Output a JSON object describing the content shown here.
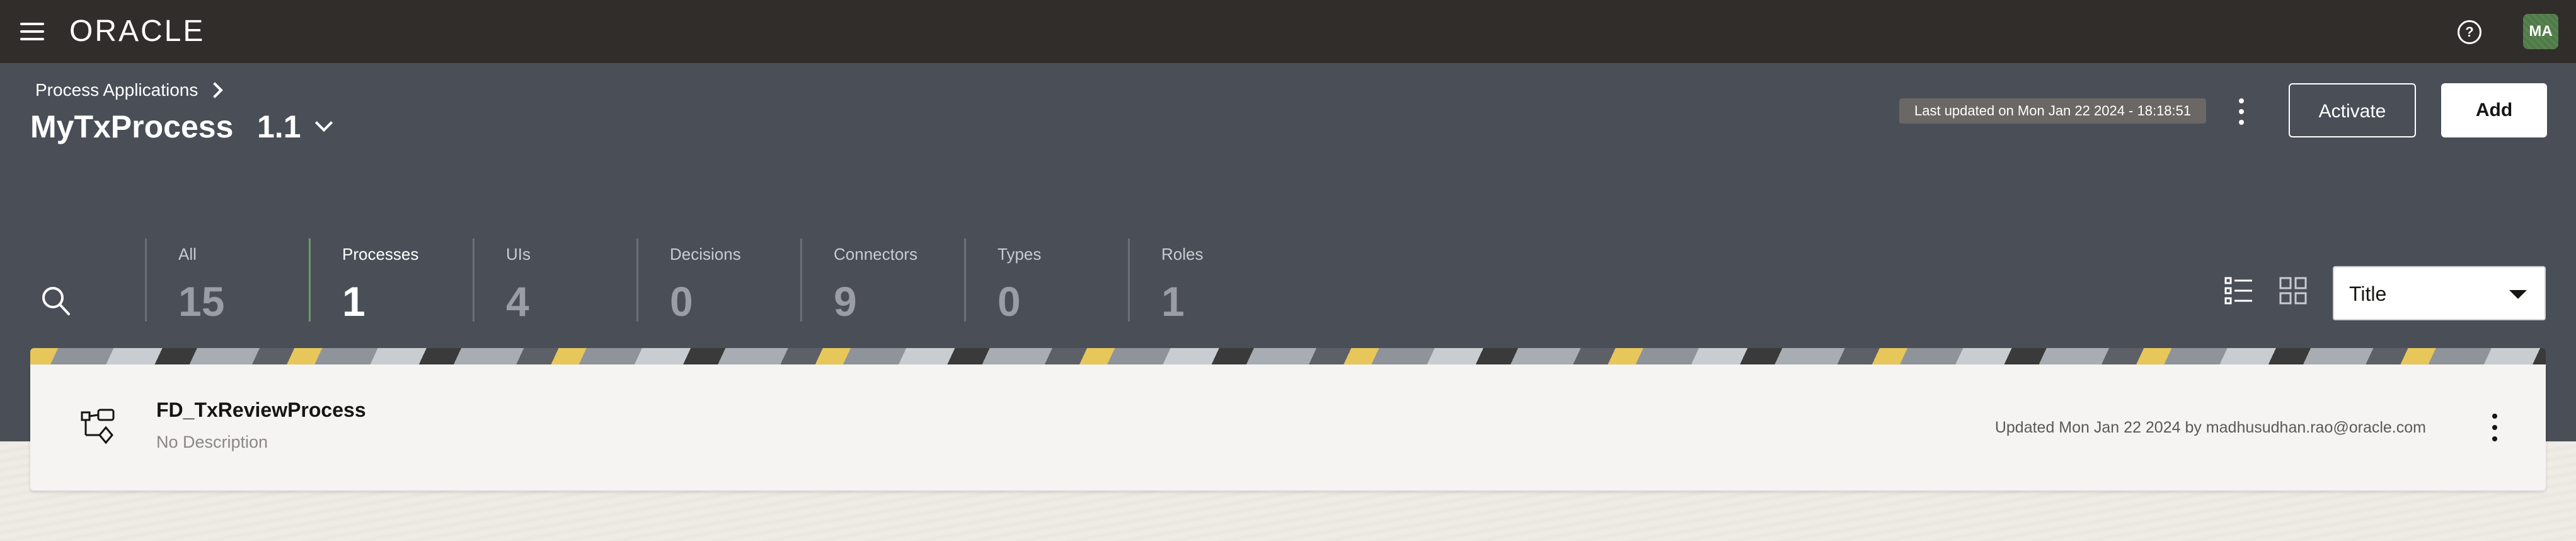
{
  "app": {
    "logo_text": "ORACLE",
    "avatar_initials": "MA",
    "help_glyph": "?"
  },
  "header": {
    "breadcrumb": "Process Applications",
    "title": "MyTxProcess",
    "version": "1.1",
    "last_updated": "Last updated on Mon Jan 22 2024 - 18:18:51",
    "activate_label": "Activate",
    "add_label": "Add"
  },
  "categories": [
    {
      "label": "All",
      "count": "15"
    },
    {
      "label": "Processes",
      "count": "1"
    },
    {
      "label": "UIs",
      "count": "4"
    },
    {
      "label": "Decisions",
      "count": "0"
    },
    {
      "label": "Connectors",
      "count": "9"
    },
    {
      "label": "Types",
      "count": "0"
    },
    {
      "label": "Roles",
      "count": "1"
    }
  ],
  "active_category": "Processes",
  "sort": {
    "selected": "Title"
  },
  "items": [
    {
      "name": "FD_TxReviewProcess",
      "description": "No Description",
      "updated": "Updated Mon Jan 22 2024 by madhusudhan.rao@oracle.com"
    }
  ],
  "colors": {
    "topbar": "#312d2a",
    "header": "#4a4e57",
    "active_accent": "#6c9a63",
    "avatar": "#4f7a47"
  }
}
